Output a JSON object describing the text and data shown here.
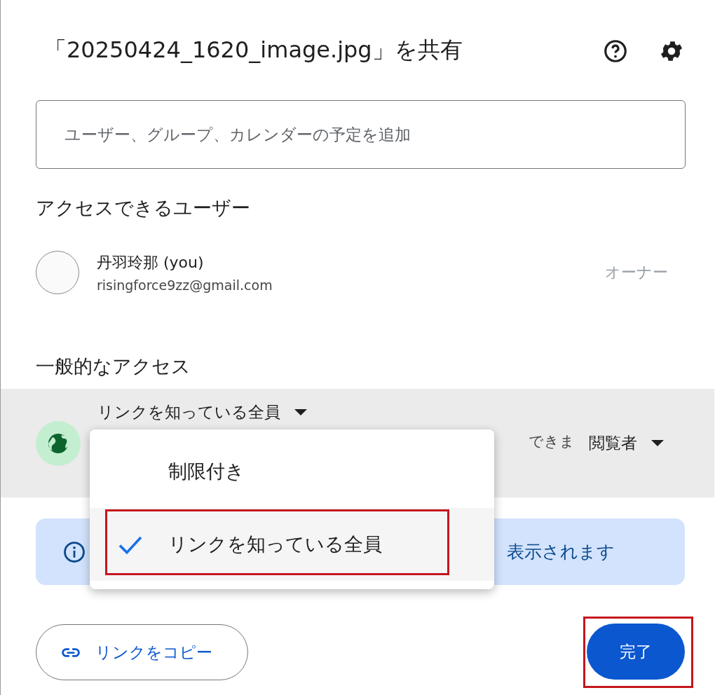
{
  "dialog": {
    "title": "「20250424_1620_image.jpg」を共有"
  },
  "share_field": {
    "placeholder": "ユーザー、グループ、カレンダーの予定を追加"
  },
  "people_section": {
    "heading": "アクセスできるユーザー",
    "people": [
      {
        "name": "丹羽玲那 (you)",
        "email": "risingforce9zz@gmail.com",
        "role": "オーナー"
      }
    ]
  },
  "general_access": {
    "heading": "一般的なアクセス",
    "scope": "リンクを知っている全員",
    "description": "できま",
    "role": "閲覧者"
  },
  "scope_menu": {
    "items": [
      {
        "label": "制限付き",
        "selected": false,
        "highlighted": false
      },
      {
        "label": "リンクを知っている全員",
        "selected": true,
        "highlighted": true
      }
    ]
  },
  "info_banner": {
    "text": "表示されます"
  },
  "buttons": [
    {
      "kind": "outline",
      "label": "リンクをコピー",
      "highlighted": false
    },
    {
      "kind": "primary",
      "label": "完了",
      "highlighted": true
    }
  ]
}
